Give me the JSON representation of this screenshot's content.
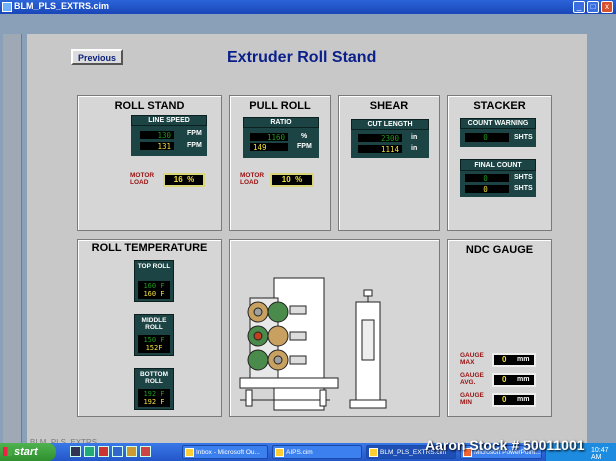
{
  "window": {
    "title": "BLM_PLS_EXTRS.cim",
    "min": "_",
    "max": "□",
    "close": "x"
  },
  "header": {
    "previous_label": "Previous",
    "title": "Extruder Roll Stand"
  },
  "roll_stand": {
    "title": "ROLL STAND",
    "line_speed_label": "LINE SPEED",
    "line_speed_set": "130",
    "line_speed_actual": "131",
    "unit": "FPM",
    "motor_load_label": "MOTOR LOAD",
    "motor_load_value": "16",
    "motor_load_unit": "%"
  },
  "pull_roll": {
    "title": "PULL ROLL",
    "ratio_label": "RATIO",
    "ratio_set": "1160",
    "ratio_actual": "149",
    "unit_pct": "%",
    "unit_fpm": "FPM",
    "motor_load_label": "MOTOR LOAD",
    "motor_load_value": "10",
    "motor_load_unit": "%"
  },
  "shear": {
    "title": "SHEAR",
    "cut_length_label": "CUT LENGTH",
    "cut_length_set": "2300",
    "cut_length_actual": "1114",
    "unit": "in"
  },
  "stacker": {
    "title": "STACKER",
    "count_warning_label": "COUNT WARNING",
    "count_warning_value": "0",
    "final_count_label": "FINAL COUNT",
    "final_count_set": "0",
    "final_count_actual": "0",
    "unit": "SHTS"
  },
  "roll_temperature": {
    "title": "ROLL TEMPERATURE",
    "rolls": [
      {
        "label": "TOP ROLL",
        "set": "160 F",
        "actual": "160 F"
      },
      {
        "label": "MIDDLE ROLL",
        "set": "150 F",
        "actual": "152F"
      },
      {
        "label": "BOTTOM ROLL",
        "set": "192 F",
        "actual": "192 F"
      }
    ]
  },
  "ndc_gauge": {
    "title": "NDC GAUGE",
    "rows": [
      {
        "label": "GAUGE MAX",
        "value": "0",
        "unit": "mm"
      },
      {
        "label": "GAUGE AVG.",
        "value": "0",
        "unit": "mm"
      },
      {
        "label": "GAUGE MIN",
        "value": "0",
        "unit": "mm"
      }
    ]
  },
  "footer": {
    "screen_name": "BLM_PLS_EXTRS"
  },
  "taskbar": {
    "start": "start",
    "tasks": [
      "Inbox - Microsoft Ou...",
      "AIPS.cim",
      "BLM_PLS_EXTRS.cim",
      "Microsoft PowerPoint..."
    ],
    "clock": "10:47 AM"
  },
  "watermark": "Aaron Stock # 50011001"
}
